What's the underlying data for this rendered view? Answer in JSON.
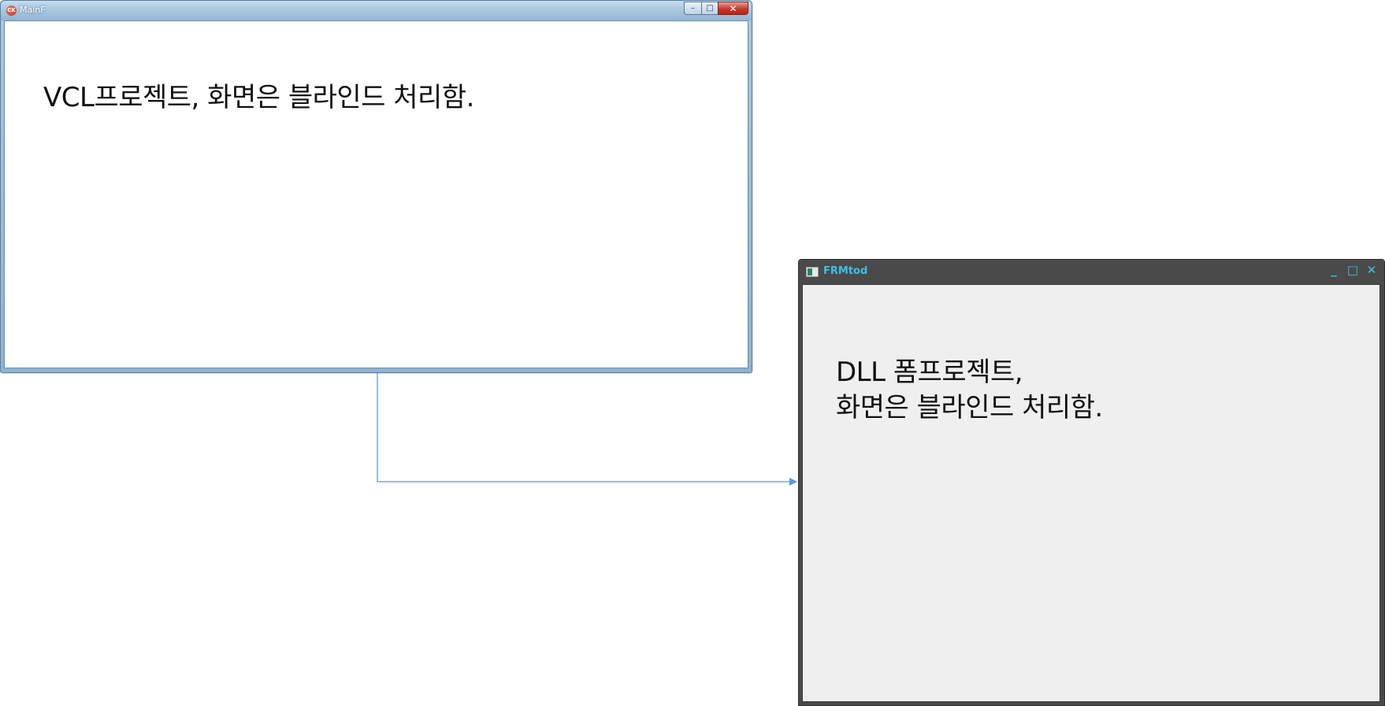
{
  "main_window": {
    "title": "MainF",
    "icon": "app-red-circle-icon",
    "icon_glyph": "CK",
    "buttons": {
      "minimize": "–",
      "maximize": "□",
      "close": "✕"
    },
    "content_text": "VCL프로젝트, 화면은 블라인드 처리함."
  },
  "dll_window": {
    "title": "FRMtod",
    "icon": "form-app-icon",
    "buttons": {
      "minimize": "_",
      "maximize": "□",
      "close": "✕"
    },
    "content_line1": "DLL 폼프로젝트,",
    "content_line2": "화면은 블라인드 처리함."
  },
  "connector": {
    "color": "#5b9bd5",
    "from": "main-window",
    "to": "dll-window"
  },
  "colors": {
    "main_frame": "#a8c6df",
    "dll_frame": "#4a4a4a",
    "dll_title": "#3fc0e8",
    "dll_client": "#efefef"
  }
}
